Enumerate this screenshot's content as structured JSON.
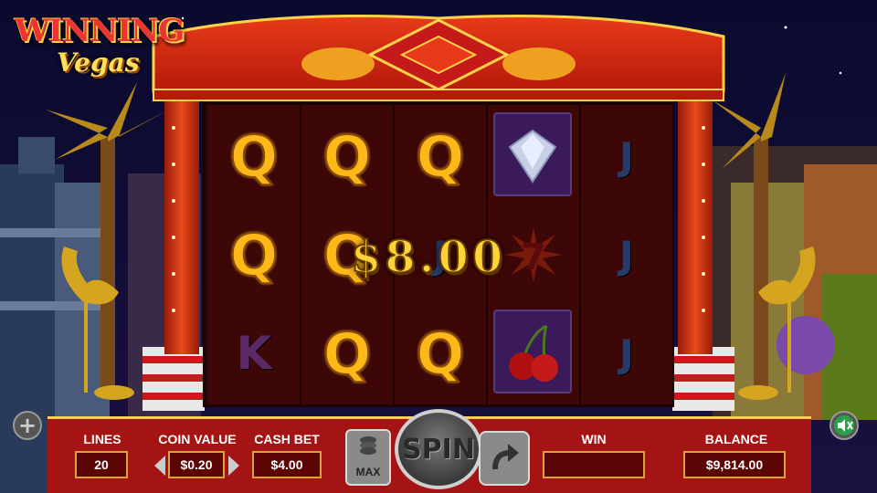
{
  "logo": {
    "line1": "WINNING",
    "line2": "Vegas"
  },
  "reels": [
    [
      "Q",
      "Q",
      "K"
    ],
    [
      "Q",
      "Q",
      "Q"
    ],
    [
      "Q",
      "J",
      "Q"
    ],
    [
      "diamond",
      "seven",
      "cherry"
    ],
    [
      "J",
      "J",
      "J"
    ]
  ],
  "win_display": "$8.00",
  "controls": {
    "lines_label": "LINES",
    "lines_value": "20",
    "coin_label": "COIN VALUE",
    "coin_value": "$0.20",
    "bet_label": "CASH BET",
    "bet_value": "$4.00",
    "max_label": "MAX",
    "spin_label": "SPIN",
    "win_label": "WIN",
    "win_value": "",
    "balance_label": "BALANCE",
    "balance_value": "$9,814.00",
    "plus_label": "+"
  },
  "colors": {
    "gold": "#ffd43a",
    "red": "#a51414",
    "gray": "#8a8a8a"
  }
}
